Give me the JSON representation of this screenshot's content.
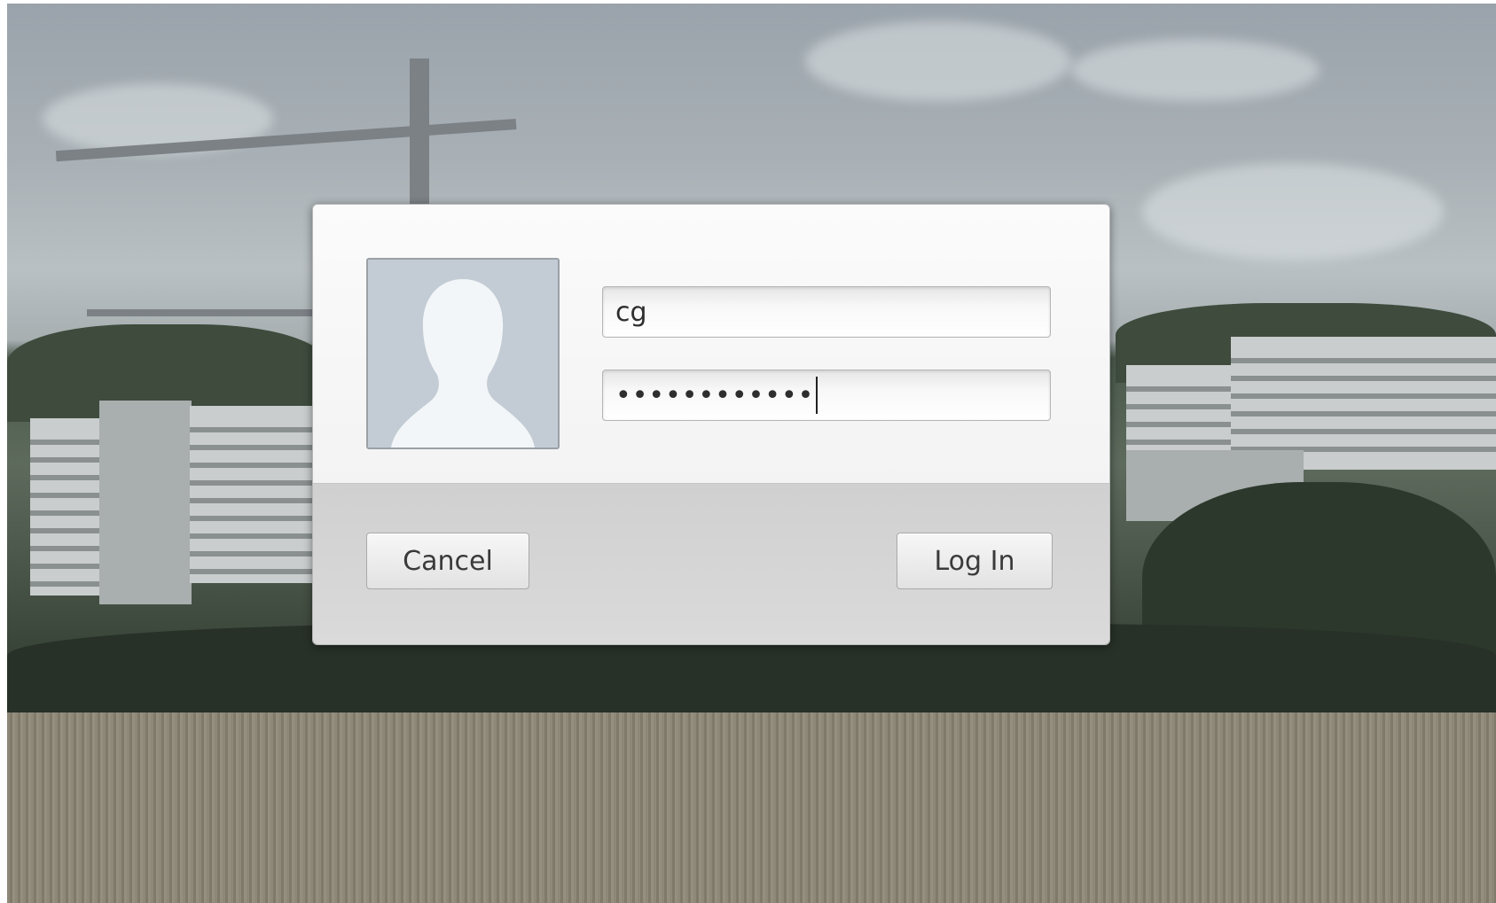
{
  "login": {
    "username_value": "cg",
    "password_value": "••••••••••••",
    "avatar_icon": "user-silhouette-icon"
  },
  "buttons": {
    "cancel_label": "Cancel",
    "login_label": "Log In"
  }
}
